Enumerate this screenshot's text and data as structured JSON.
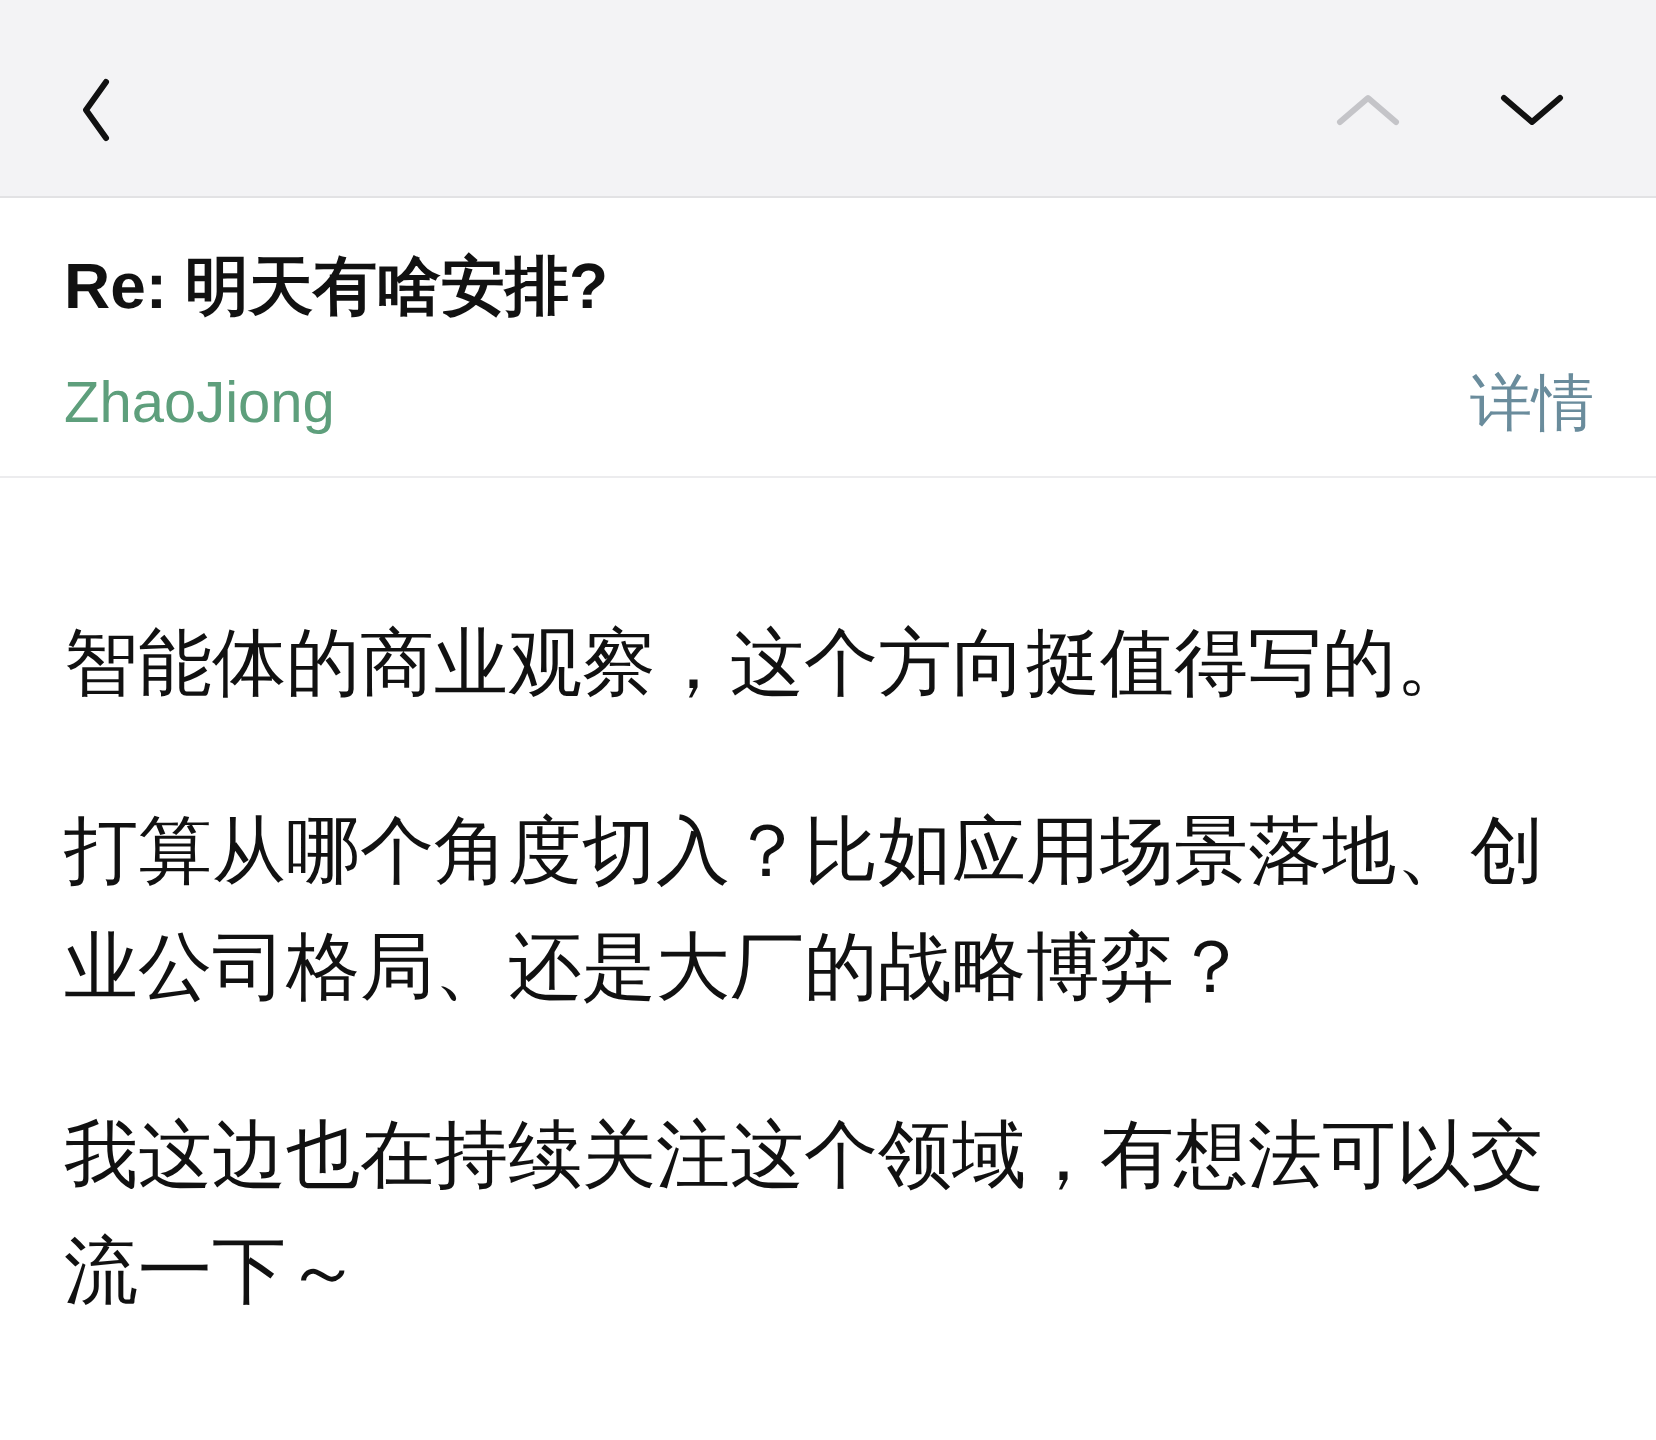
{
  "toolbar": {
    "buttons": [
      {
        "kind": "back",
        "disabled": false
      },
      {
        "kind": "previous",
        "disabled": true
      },
      {
        "kind": "next",
        "disabled": false
      }
    ]
  },
  "message": {
    "subject": "Re: 明天有啥安排?",
    "sender": "ZhaoJiong",
    "details_link": "详情",
    "body": [
      "智能体的商业观察，这个方向挺值得写的。",
      "打算从哪个角度切入？比如应用场景落地、创业公司格局、还是大厂的战略博弈？",
      "我这边也在持续关注这个领域，有想法可以交流一下～"
    ]
  }
}
